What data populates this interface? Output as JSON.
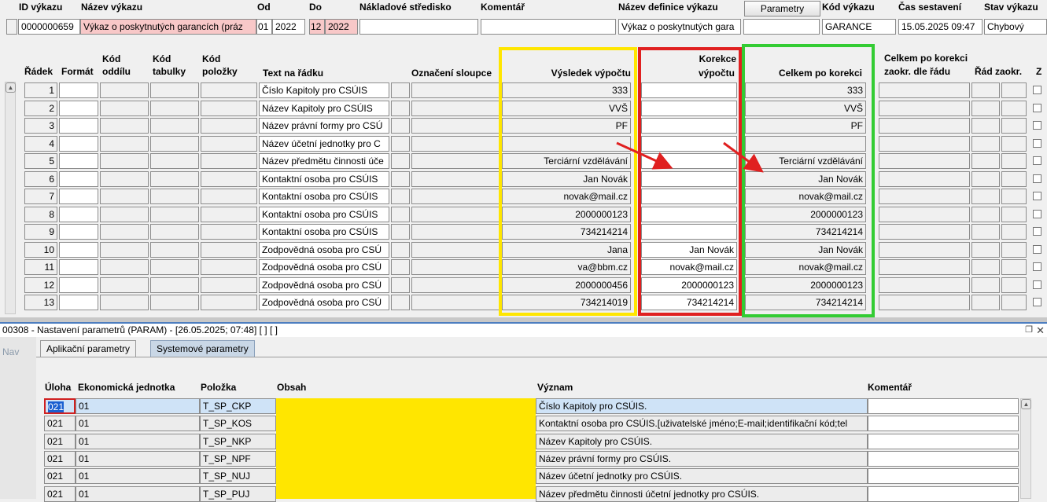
{
  "report_header": {
    "labels": {
      "id": "ID výkazu",
      "name": "Název výkazu",
      "from": "Od",
      "to": "Do",
      "cost_center": "Nákladové středisko",
      "comment": "Komentář",
      "definition_name": "Název definice výkazu",
      "code": "Kód výkazu",
      "built_time": "Čas sestavení",
      "state": "Stav výkazu"
    },
    "values": {
      "id": "0000000659",
      "name": "Výkaz o poskytnutých garancích (práz",
      "from_month": "01",
      "from_year": "2022",
      "to_month": "12",
      "to_year": "2022",
      "cost_center": "",
      "comment": "",
      "definition_name": "Výkaz o poskytnutých gara",
      "code": "GARANCE",
      "built_time": "15.05.2025 09:47",
      "state": "Chybový"
    },
    "params_button": "Parametry"
  },
  "grid": {
    "headers": {
      "row": "Řádek",
      "format": "Formát",
      "section_code": [
        "Kód",
        "oddílu"
      ],
      "table_code": [
        "Kód",
        "tabulky"
      ],
      "item_code": [
        "Kód",
        "položky"
      ],
      "row_text": "Text na řádku",
      "column_mark": "Označení sloupce",
      "calc_result": "Výsledek výpočtu",
      "calc_correction": [
        "Korekce",
        "výpočtu"
      ],
      "total_after": "Celkem po korekci",
      "total_rounded": [
        "Celkem po korekci",
        "zaokr. dle řádu"
      ],
      "rounding_order": "Řád zaokr.",
      "z": "Z"
    },
    "rows": [
      {
        "n": "1",
        "text": "Číslo Kapitoly pro CSÚIS",
        "result": "333",
        "correction": "",
        "total": "333"
      },
      {
        "n": "2",
        "text": "Název Kapitoly pro CSÚIS",
        "result": "VVŠ",
        "correction": "",
        "total": "VVŠ"
      },
      {
        "n": "3",
        "text": "Název právní formy pro CSÚ",
        "result": "PF",
        "correction": "",
        "total": "PF"
      },
      {
        "n": "4",
        "text": "Název účetní jednotky pro C",
        "result": "",
        "correction": "",
        "total": ""
      },
      {
        "n": "5",
        "text": "Název předmětu činnosti úče",
        "result": "Terciární vzdělávání",
        "correction": "",
        "total": "Terciární vzdělávání"
      },
      {
        "n": "6",
        "text": "Kontaktní osoba pro CSÚIS",
        "result": "Jan Novák",
        "correction": "",
        "total": "Jan Novák"
      },
      {
        "n": "7",
        "text": "Kontaktní osoba pro CSÚIS",
        "result": "novak@mail.cz",
        "correction": "",
        "total": "novak@mail.cz"
      },
      {
        "n": "8",
        "text": "Kontaktní osoba pro CSÚIS",
        "result": "2000000123",
        "correction": "",
        "total": "2000000123"
      },
      {
        "n": "9",
        "text": "Kontaktní osoba pro CSÚIS",
        "result": "734214214",
        "correction": "",
        "total": "734214214"
      },
      {
        "n": "10",
        "text": "Zodpovědná osoba pro CSÚ",
        "result": "Jana",
        "correction": "Jan Novák",
        "total": "Jan Novák"
      },
      {
        "n": "11",
        "text": "Zodpovědná osoba pro CSÚ",
        "result": "va@bbm.cz",
        "correction": "novak@mail.cz",
        "total": "novak@mail.cz"
      },
      {
        "n": "12",
        "text": "Zodpovědná osoba pro CSÚ",
        "result": "2000000456",
        "correction": "2000000123",
        "total": "2000000123"
      },
      {
        "n": "13",
        "text": "Zodpovědná osoba pro CSÚ",
        "result": "734214019",
        "correction": "734214214",
        "total": "734214214"
      }
    ]
  },
  "param_window": {
    "title": "00308 - Nastavení parametrů (PARAM) - [26.05.2025; 07:48]  [ ] [ ]",
    "nav": "Nav",
    "tabs": [
      "Aplikační parametry",
      "Systemové parametry"
    ],
    "headers": {
      "task": "Úloha",
      "unit": "Ekonomická jednotka",
      "item": "Položka",
      "content": "Obsah",
      "meaning": "Význam",
      "comment": "Komentář"
    },
    "rows": [
      {
        "task": "021",
        "unit": "01",
        "item": "T_SP_CKP",
        "content": "",
        "meaning": "Číslo Kapitoly pro CSÚIS.",
        "comment": ""
      },
      {
        "task": "021",
        "unit": "01",
        "item": "T_SP_KOS",
        "content": "",
        "meaning": "Kontaktní osoba pro CSÚIS.[uživatelské jméno;E-mail;identifikační kód;tel",
        "comment": ""
      },
      {
        "task": "021",
        "unit": "01",
        "item": "T_SP_NKP",
        "content": "",
        "meaning": "Název Kapitoly pro CSÚIS.",
        "comment": ""
      },
      {
        "task": "021",
        "unit": "01",
        "item": "T_SP_NPF",
        "content": "",
        "meaning": "Název právní formy pro CSÚIS.",
        "comment": ""
      },
      {
        "task": "021",
        "unit": "01",
        "item": "T_SP_NUJ",
        "content": "",
        "meaning": "Název účetní jednotky pro CSÚIS.",
        "comment": ""
      },
      {
        "task": "021",
        "unit": "01",
        "item": "T_SP_PUJ",
        "content": "",
        "meaning": "Název předmětu činnosti účetní jednotky pro CSÚIS.",
        "comment": ""
      }
    ]
  },
  "colors": {
    "yellow_highlight": "#ffe600",
    "red_highlight": "#e02020",
    "green_highlight": "#33cc33",
    "pink_field": "#f8c8c8",
    "selection": "#cfe3f7",
    "window_border": "#4d7ec0"
  },
  "icons": {
    "scroll_up": "chevron-up-icon",
    "restore": "restore-window-icon",
    "close": "close-icon"
  }
}
